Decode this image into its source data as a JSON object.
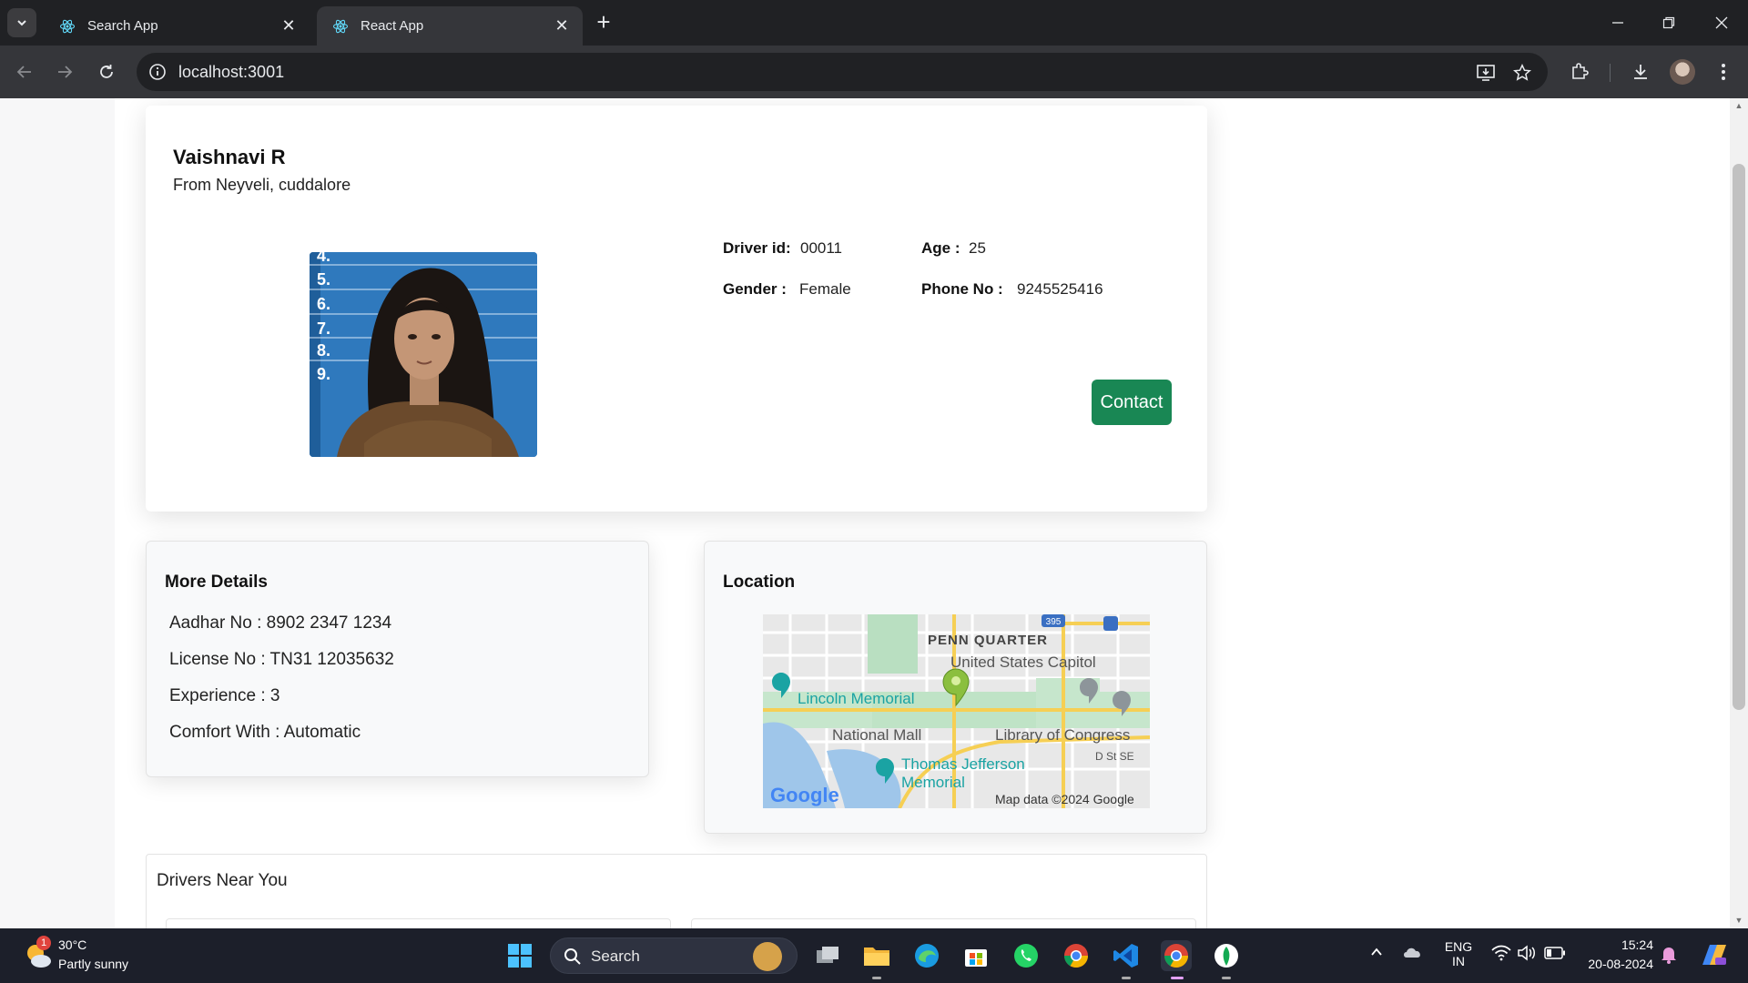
{
  "browser": {
    "tabs": [
      {
        "label": "Search App",
        "active": false
      },
      {
        "label": "React App",
        "active": true
      }
    ],
    "url": "localhost:3001"
  },
  "profile": {
    "name": "Vaishnavi R",
    "from": "From Neyveli, cuddalore",
    "driver_id_label": "Driver id:",
    "driver_id": "00011",
    "age_label": "Age :",
    "age": "25",
    "gender_label": "Gender :",
    "gender": "Female",
    "phone_label": "Phone No :",
    "phone": "9245525416",
    "contact_button": "Contact",
    "accent_color": "#198754"
  },
  "more_details": {
    "title": "More Details",
    "lines": [
      "Aadhar No : 8902 2347 1234",
      "License No : TN31 12035632",
      "Experience : 3",
      "Comfort With : Automatic"
    ]
  },
  "location": {
    "title": "Location",
    "map_labels": {
      "penn_quarter": "PENN QUARTER",
      "capitol": "United States Capitol",
      "lincoln": "Lincoln Memorial",
      "mall": "National Mall",
      "library": "Library of Congress",
      "jefferson_1": "Thomas Jefferson",
      "jefferson_2": "Memorial",
      "dst": "D St SE",
      "highway": "395",
      "attribution": "Map data ©2024 Google",
      "logo": "Google"
    }
  },
  "nearby": {
    "title": "Drivers Near You"
  },
  "taskbar": {
    "weather_temp": "30°C",
    "weather_desc": "Partly sunny",
    "weather_badge": "1",
    "search_label": "Search",
    "lang_1": "ENG",
    "lang_2": "IN",
    "time": "15:24",
    "date": "20-08-2024"
  }
}
